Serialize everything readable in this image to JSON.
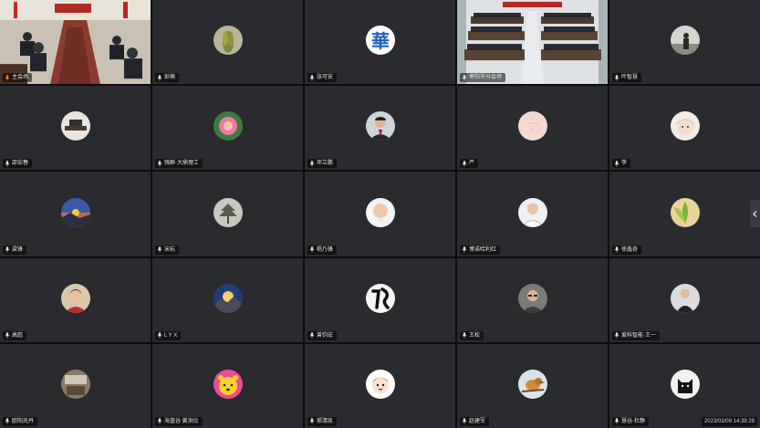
{
  "app": {
    "timestamp": "2023/03/09 14:39:29",
    "colors": {
      "tile_bg": "#2a2b2f",
      "gap": "#0c0c0e",
      "label_bg": "#000000",
      "label_text": "#e8e8e8"
    }
  },
  "participants": [
    {
      "name": "主会场",
      "tile_type": "video-meeting-table",
      "icon": "mic-active-icon"
    },
    {
      "name": "彭楠",
      "tile_type": "avatar",
      "avatar": "wheat-photo"
    },
    {
      "name": "张可安",
      "tile_type": "avatar",
      "avatar": "hua-logo"
    },
    {
      "name": "枣阳市分会场",
      "tile_type": "video-auditorium"
    },
    {
      "name": "叶智慧",
      "tile_type": "avatar",
      "avatar": "outdoor-figure"
    },
    {
      "name": "邵宏春",
      "tile_type": "avatar",
      "avatar": "desk-photo"
    },
    {
      "name": "强群·大鼎理工",
      "tile_type": "avatar",
      "avatar": "lotus-flower"
    },
    {
      "name": "邓立鹏",
      "tile_type": "avatar",
      "avatar": "man-in-suit"
    },
    {
      "name": "严",
      "tile_type": "avatar",
      "avatar": "pink-text-badge"
    },
    {
      "name": "李",
      "tile_type": "avatar",
      "avatar": "cartoon-girl"
    },
    {
      "name": "梁锋",
      "tile_type": "avatar",
      "avatar": "landscape-sunset"
    },
    {
      "name": "宋杭",
      "tile_type": "avatar",
      "avatar": "tree-silhouette"
    },
    {
      "name": "杨乃锋",
      "tile_type": "avatar",
      "avatar": "bald-man"
    },
    {
      "name": "博诺哈利红",
      "tile_type": "avatar",
      "avatar": "young-man-white-shirt"
    },
    {
      "name": "徐鑫奇",
      "tile_type": "avatar",
      "avatar": "green-plant"
    },
    {
      "name": "高彪",
      "tile_type": "avatar",
      "avatar": "boy-red-shirt"
    },
    {
      "name": "L Y X",
      "tile_type": "avatar",
      "avatar": "mountain-sky"
    },
    {
      "name": "曾钧宏",
      "tile_type": "avatar",
      "avatar": "calligraphy-fo"
    },
    {
      "name": "王松",
      "tile_type": "avatar",
      "avatar": "man-with-glasses"
    },
    {
      "name": "爱科智能·王一",
      "tile_type": "avatar",
      "avatar": "man-dark-suit"
    },
    {
      "name": "欧阳兆丹",
      "tile_type": "avatar",
      "avatar": "room-interior"
    },
    {
      "name": "海蓝谷 黄洪仪",
      "tile_type": "avatar",
      "avatar": "yellow-cartoon-bear"
    },
    {
      "name": "郝清凯",
      "tile_type": "avatar",
      "avatar": "cartoon-boy"
    },
    {
      "name": "赵建军",
      "tile_type": "avatar",
      "avatar": "bird-photo"
    },
    {
      "name": "慧谷·杜静",
      "tile_type": "avatar",
      "avatar": "black-cat"
    }
  ]
}
